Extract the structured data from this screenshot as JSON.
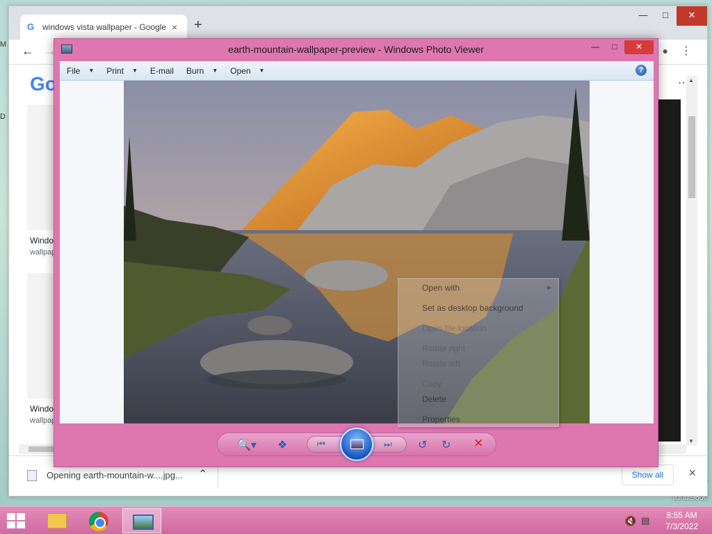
{
  "browser": {
    "tab_title": "windows vista wallpaper - Google",
    "tab_close": "×",
    "new_tab": "+",
    "logo_text": "Go",
    "results": [
      {
        "label": "Windo",
        "sub": "wallpap"
      },
      {
        "label": "Windo",
        "sub": "wallpap"
      }
    ],
    "downloads": {
      "file_text": "Opening earth-mountain-w....jpg...",
      "show_all": "Show all",
      "close": "×"
    }
  },
  "desktop": {
    "left_glyph_1": "M",
    "left_glyph_2": "D",
    "right_text_1": "o",
    "right_text_2": "ildnu.9600"
  },
  "photo_viewer": {
    "title": "earth-mountain-wallpaper-preview - Windows Photo Viewer",
    "menus": [
      {
        "label": "File",
        "has_dropdown": true
      },
      {
        "label": "Print",
        "has_dropdown": true
      },
      {
        "label": "E-mail",
        "has_dropdown": false
      },
      {
        "label": "Burn",
        "has_dropdown": true
      },
      {
        "label": "Open",
        "has_dropdown": true
      }
    ],
    "help": "?",
    "context_menu": [
      {
        "label": "Open with",
        "submenu": true,
        "enabled": true
      },
      {
        "label": "Set as desktop background",
        "submenu": false,
        "enabled": true
      },
      {
        "label": "Open file location",
        "submenu": false,
        "enabled": false
      },
      {
        "label": "Rotate right",
        "submenu": false,
        "enabled": false
      },
      {
        "label": "Rotate left",
        "submenu": false,
        "enabled": false
      },
      {
        "label": "Copy",
        "submenu": false,
        "enabled": false
      },
      {
        "label": "Delete",
        "submenu": false,
        "enabled": true
      },
      {
        "label": "Properties",
        "submenu": false,
        "enabled": true
      }
    ]
  },
  "taskbar": {
    "time": "8:55 AM",
    "date": "7/3/2022"
  },
  "icons": {
    "back": "back-arrow-icon",
    "forward": "forward-arrow-icon",
    "zoom": "magnifier-zoom-icon",
    "fit": "actual-size-icon",
    "prev": "previous-icon",
    "next": "next-icon",
    "rotate_ccw": "rotate-counterclockwise-icon",
    "rotate_cw": "rotate-clockwise-icon",
    "delete": "delete-x-icon"
  },
  "colors": {
    "viewer_frame": "#de76b0",
    "taskbar": "#cf6aa0",
    "chrome_link": "#1a73e8"
  }
}
